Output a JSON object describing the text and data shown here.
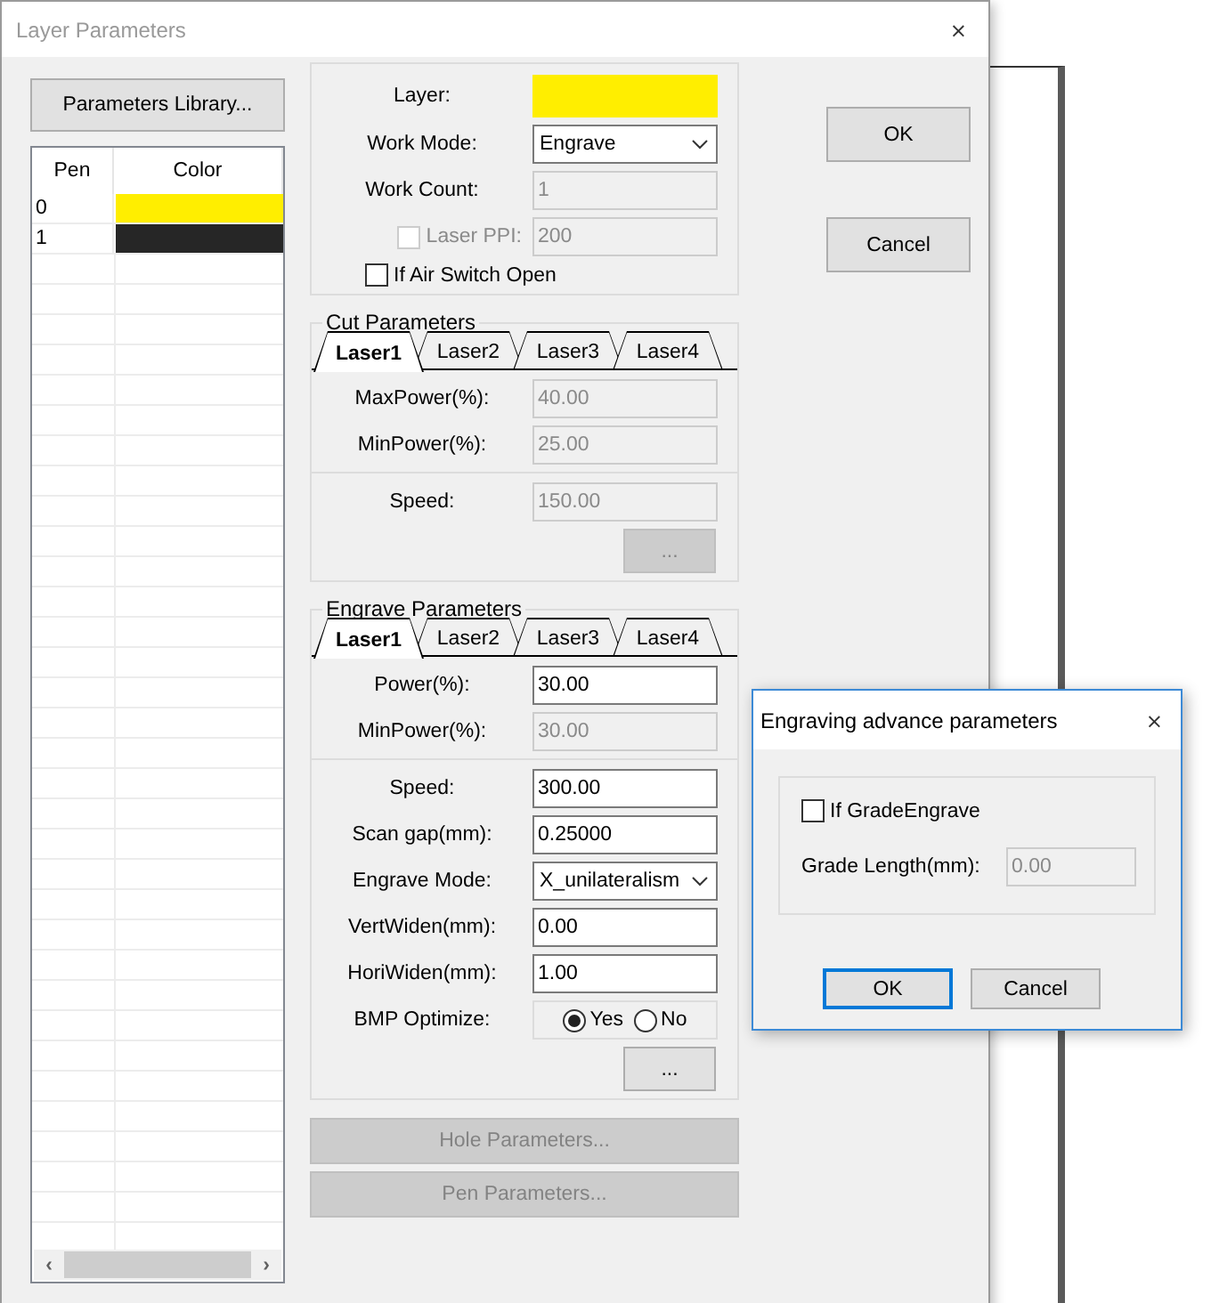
{
  "window": {
    "title": "Layer Parameters",
    "close": "×"
  },
  "library_button": "Parameters Library...",
  "pen_table": {
    "columns": [
      "Pen",
      "Color"
    ],
    "rows": [
      {
        "pen": "0",
        "color": "#ffee00"
      },
      {
        "pen": "1",
        "color": "#262626"
      }
    ],
    "scroll_left": "‹",
    "scroll_right": "›"
  },
  "layer_group": {
    "rows": [
      {
        "kind": "color",
        "label": "Layer:",
        "color": "#ffee00"
      },
      {
        "kind": "select",
        "label": "Work Mode:",
        "value": "Engrave"
      },
      {
        "kind": "input",
        "label": "Work Count:",
        "value": "1",
        "disabled": true
      },
      {
        "kind": "checkinput",
        "label": "Laser PPI:",
        "value": "200",
        "checked": false,
        "disabled": true
      },
      {
        "kind": "checkbox",
        "label": "If Air Switch Open",
        "checked": false,
        "disabled": false
      }
    ]
  },
  "cut_parameters": {
    "title": "Cut Parameters",
    "tabs": [
      {
        "label": "Laser1",
        "selected": true
      },
      {
        "label": "Laser2",
        "selected": false
      },
      {
        "label": "Laser3",
        "selected": false
      },
      {
        "label": "Laser4",
        "selected": false
      }
    ],
    "sections": [
      [
        {
          "kind": "input",
          "label": "MaxPower(%):",
          "value": "40.00",
          "disabled": true
        },
        {
          "kind": "input",
          "label": "MinPower(%):",
          "value": "25.00",
          "disabled": true
        }
      ],
      [
        {
          "kind": "input",
          "label": "Speed:",
          "value": "150.00",
          "disabled": true
        },
        {
          "kind": "button",
          "label": "...",
          "disabled": true
        }
      ]
    ]
  },
  "engrave_parameters": {
    "title": "Engrave Parameters",
    "tabs": [
      {
        "label": "Laser1",
        "selected": true
      },
      {
        "label": "Laser2",
        "selected": false
      },
      {
        "label": "Laser3",
        "selected": false
      },
      {
        "label": "Laser4",
        "selected": false
      }
    ],
    "sections": [
      [
        {
          "kind": "input",
          "label": "Power(%):",
          "value": "30.00",
          "disabled": false
        },
        {
          "kind": "input",
          "label": "MinPower(%):",
          "value": "30.00",
          "disabled": true
        }
      ],
      [
        {
          "kind": "input",
          "label": "Speed:",
          "value": "300.00",
          "disabled": false
        },
        {
          "kind": "input",
          "label": "Scan gap(mm):",
          "value": "0.25000",
          "disabled": false
        },
        {
          "kind": "select",
          "label": "Engrave Mode:",
          "value": "X_unilateralism"
        },
        {
          "kind": "input",
          "label": "VertWiden(mm):",
          "value": "0.00",
          "disabled": false
        },
        {
          "kind": "input",
          "label": "HoriWiden(mm):",
          "value": "1.00",
          "disabled": false
        },
        {
          "kind": "radio",
          "label": "BMP Optimize:",
          "options": [
            {
              "label": "Yes",
              "selected": true
            },
            {
              "label": "No",
              "selected": false
            }
          ]
        },
        {
          "kind": "button",
          "label": "...",
          "disabled": false
        }
      ]
    ]
  },
  "bottom_buttons": [
    {
      "label": "Hole Parameters...",
      "disabled": true
    },
    {
      "label": "Pen Parameters...",
      "disabled": true
    }
  ],
  "dialog_buttons": [
    "OK",
    "Cancel"
  ],
  "advance_dialog": {
    "title": "Engraving advance parameters",
    "close": "×",
    "checkbox": {
      "label": "If GradeEngrave",
      "checked": false
    },
    "field": {
      "label": "Grade Length(mm):",
      "value": "0.00",
      "disabled": true
    },
    "buttons": [
      {
        "label": "OK",
        "default": true
      },
      {
        "label": "Cancel",
        "default": false
      }
    ]
  }
}
